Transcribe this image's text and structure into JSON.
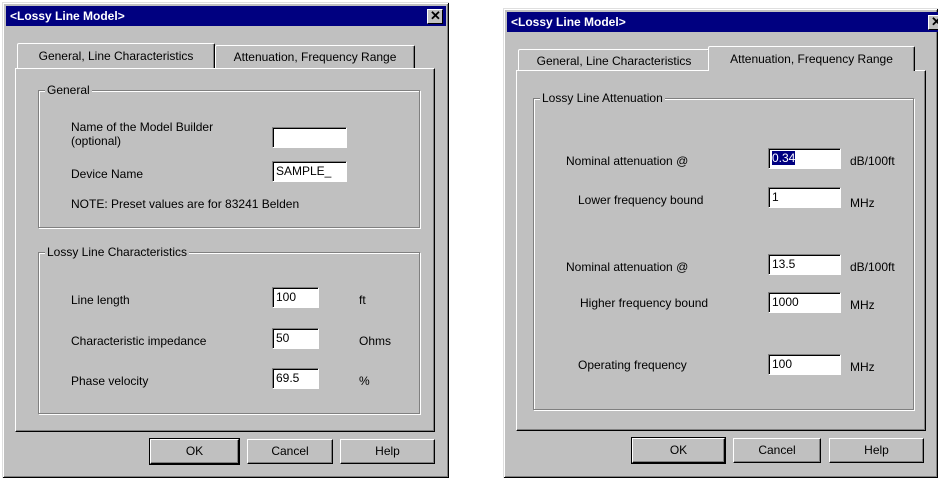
{
  "left_dialog": {
    "title": "<Lossy Line Model>",
    "close_glyph": "✕",
    "tabs": [
      "General, Line  Characteristics",
      "Attenuation, Frequency Range"
    ],
    "active_tab": 0,
    "general_group": {
      "label": "General",
      "model_builder_label_1": "Name of the Model Builder",
      "model_builder_label_2": "(optional)",
      "model_builder_value": "",
      "device_name_label": "Device Name",
      "device_name_value": "SAMPLE_",
      "note": "NOTE: Preset values are for 83241 Belden"
    },
    "line_group": {
      "label": "Lossy Line  Characteristics",
      "line_length_label": "Line length",
      "line_length_value": "100",
      "line_length_unit": "ft",
      "impedance_label": "Characteristic impedance",
      "impedance_value": "50",
      "impedance_unit": "Ohms",
      "velocity_label": "Phase velocity",
      "velocity_value": "69.5",
      "velocity_unit": "%"
    },
    "buttons": {
      "ok": "OK",
      "cancel": "Cancel",
      "help": "Help"
    }
  },
  "right_dialog": {
    "title": "<Lossy Line Model>",
    "close_glyph": "✕",
    "tabs": [
      "General, Line  Characteristics",
      "Attenuation, Frequency Range"
    ],
    "active_tab": 1,
    "atten_group": {
      "label": "Lossy Line Attenuation",
      "nominal1_label": "Nominal attenuation @",
      "nominal1_value": "0.34",
      "nominal1_unit": "dB/100ft",
      "lower_label": "Lower frequency bound",
      "lower_value": "1",
      "lower_unit": "MHz",
      "nominal2_label": "Nominal attenuation @",
      "nominal2_value": "13.5",
      "nominal2_unit": "dB/100ft",
      "higher_label": "Higher frequency bound",
      "higher_value": "1000",
      "higher_unit": "MHz",
      "operating_label": "Operating frequency",
      "operating_value": "100",
      "operating_unit": "MHz"
    },
    "buttons": {
      "ok": "OK",
      "cancel": "Cancel",
      "help": "Help"
    }
  },
  "colors": {
    "titlebar": "#000080",
    "face": "#c0c0c0",
    "selection": "#000080"
  }
}
